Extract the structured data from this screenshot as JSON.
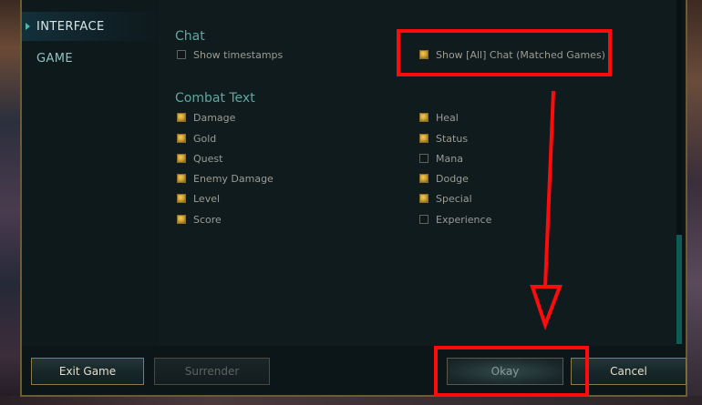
{
  "nav": {
    "items": [
      {
        "label": "INTERFACE",
        "active": true
      },
      {
        "label": "GAME",
        "active": false
      }
    ]
  },
  "chat": {
    "title": "Chat",
    "options": [
      {
        "label": "Show timestamps",
        "checked": false
      },
      {
        "label": "Show [All] Chat (Matched Games)",
        "checked": true
      }
    ]
  },
  "combat_text": {
    "title": "Combat Text",
    "left": [
      {
        "label": "Damage",
        "checked": true
      },
      {
        "label": "Gold",
        "checked": true
      },
      {
        "label": "Quest",
        "checked": true
      },
      {
        "label": "Enemy Damage",
        "checked": true
      },
      {
        "label": "Level",
        "checked": true
      },
      {
        "label": "Score",
        "checked": true
      }
    ],
    "right": [
      {
        "label": "Heal",
        "checked": true
      },
      {
        "label": "Status",
        "checked": true
      },
      {
        "label": "Mana",
        "checked": false
      },
      {
        "label": "Dodge",
        "checked": true
      },
      {
        "label": "Special",
        "checked": true
      },
      {
        "label": "Experience",
        "checked": false
      }
    ]
  },
  "footer": {
    "exit_label": "Exit Game",
    "surrender_label": "Surrender",
    "okay_label": "Okay",
    "cancel_label": "Cancel"
  },
  "colors": {
    "accent": "#5fa7a0",
    "checkbox_checked": "#c99a2a",
    "annotation": "#ff0b0b"
  }
}
